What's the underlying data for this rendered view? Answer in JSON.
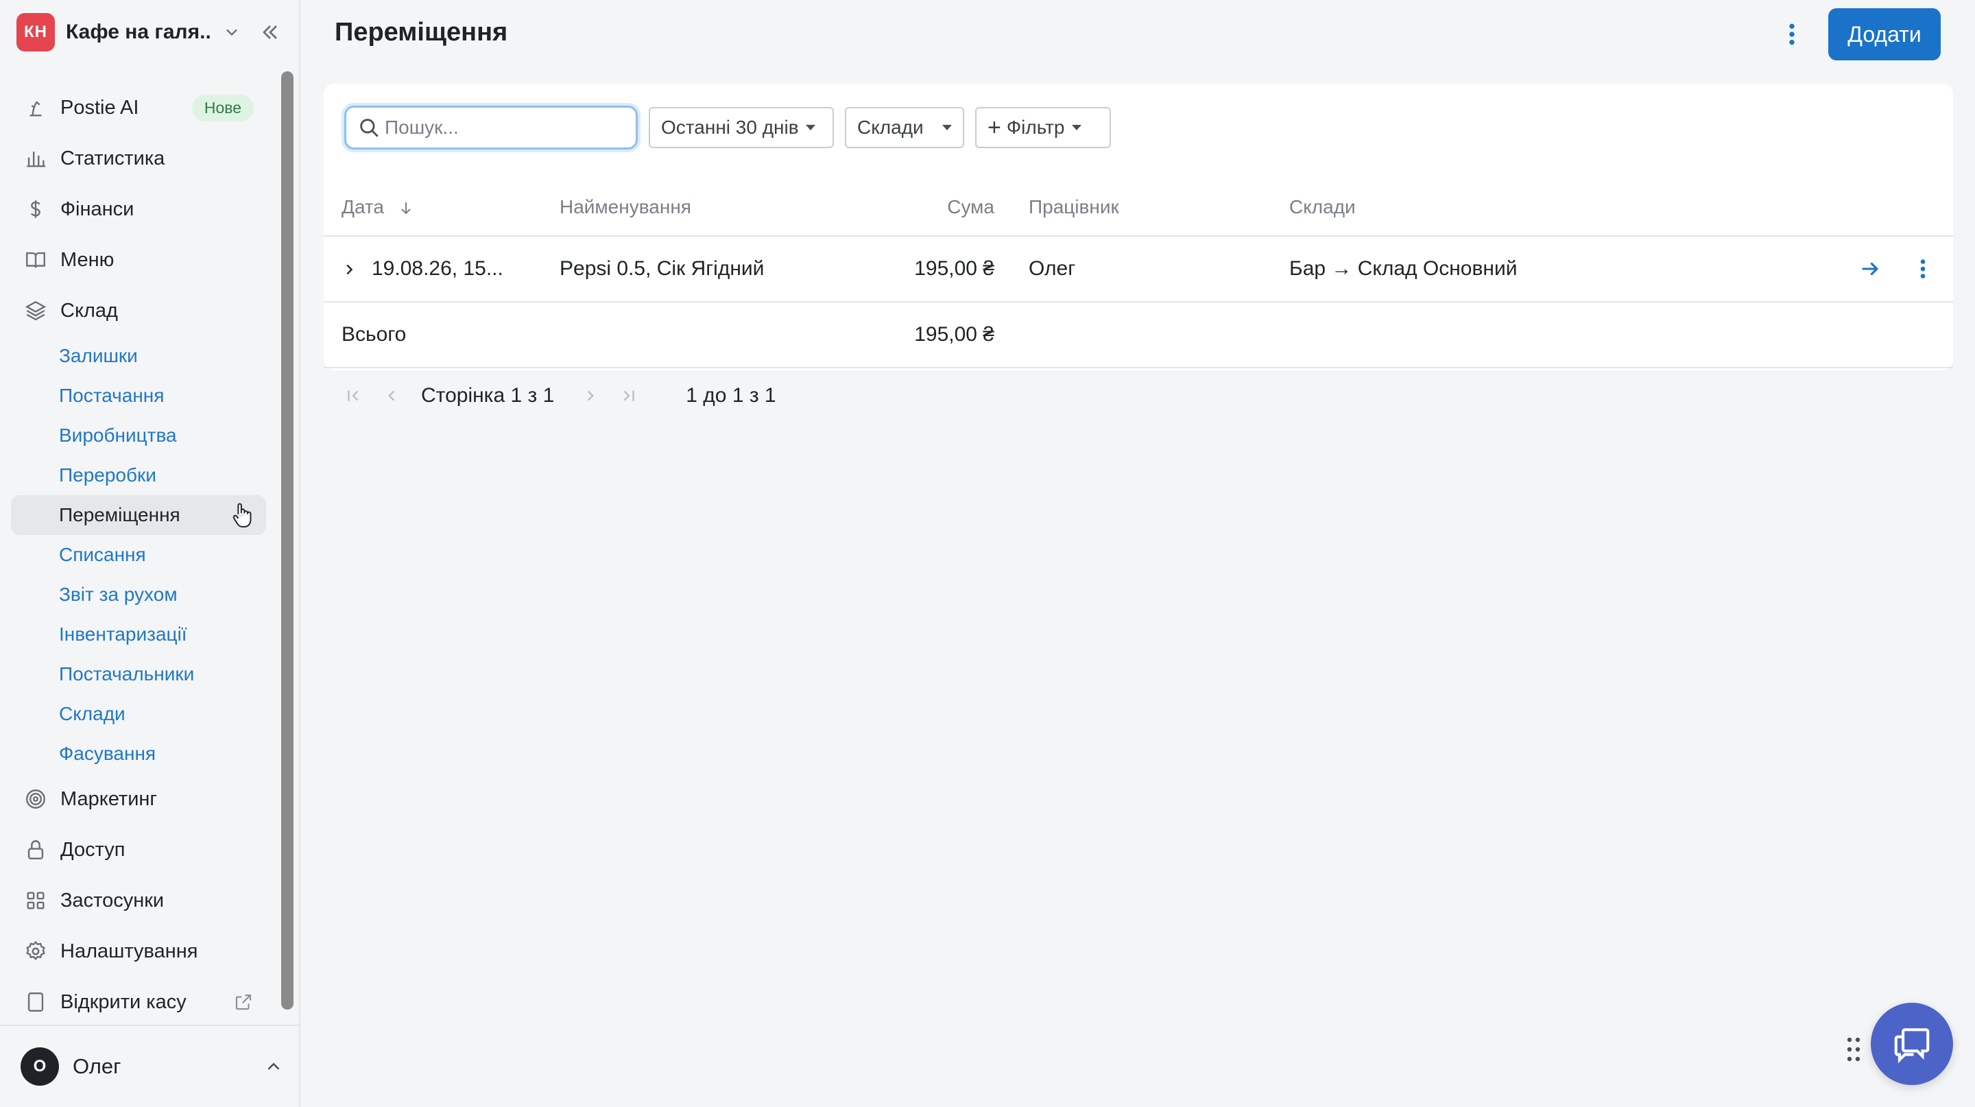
{
  "brand": {
    "initials": "КН",
    "name": "Кафе на галя..."
  },
  "nav": {
    "postie": {
      "label": "Postie AI",
      "badge": "Нове"
    },
    "stats": "Статистика",
    "finance": "Фінанси",
    "menu": "Меню",
    "warehouse": "Склад",
    "sub": [
      "Залишки",
      "Постачання",
      "Виробництва",
      "Переробки",
      "Переміщення",
      "Списання",
      "Звіт за рухом",
      "Інвентаризації",
      "Постачальники",
      "Склади",
      "Фасування"
    ],
    "marketing": "Маркетинг",
    "access": "Доступ",
    "apps": "Застосунки",
    "settings": "Налаштування",
    "open_register": "Відкрити касу"
  },
  "user": {
    "initial": "О",
    "name": "Олег"
  },
  "header": {
    "title": "Переміщення",
    "add_label": "Додати"
  },
  "filters": {
    "search_placeholder": "Пошук...",
    "period": "Останні 30 днів",
    "warehouses": "Склади",
    "filter": "Фільтр"
  },
  "table": {
    "columns": {
      "date": "Дата",
      "name": "Найменування",
      "sum": "Сума",
      "employee": "Працівник",
      "warehouses": "Склади"
    },
    "rows": [
      {
        "date": "19.08.26, 15...",
        "name": "Pepsi 0.5, Сік Ягідний",
        "sum": "195,00 ₴",
        "employee": "Олег",
        "warehouses": "Бар → Склад Основний"
      }
    ],
    "total": {
      "label": "Всього",
      "sum": "195,00 ₴"
    }
  },
  "pager": {
    "page_text": "Сторінка 1 з 1",
    "range_text": "1 до 1 з 1"
  },
  "colors": {
    "accent": "#1a73c9",
    "brand_badge": "#e5454f",
    "chat": "#4c63c8"
  }
}
